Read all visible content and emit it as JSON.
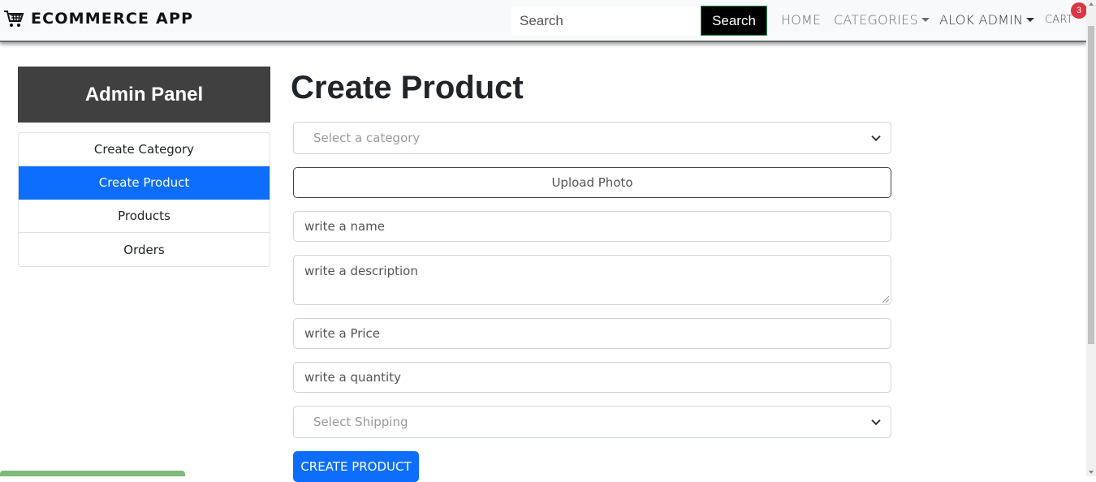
{
  "brand": {
    "title": "ECOMMERCE APP",
    "logo_icon": "shopping-cart-icon"
  },
  "search": {
    "placeholder": "Search",
    "button_label": "Search"
  },
  "nav": {
    "home": "HOME",
    "categories": "CATEGORIES",
    "user": "ALOK ADMIN",
    "cart": "CART",
    "cart_count": "3"
  },
  "sidebar": {
    "heading": "Admin Panel",
    "items": [
      {
        "label": "Create Category",
        "active": false
      },
      {
        "label": "Create Product",
        "active": true
      },
      {
        "label": "Products",
        "active": false
      },
      {
        "label": "Orders",
        "active": false
      }
    ]
  },
  "form": {
    "title": "Create Product",
    "category_placeholder": "Select a category",
    "upload_label": "Upload Photo",
    "name_placeholder": "write a name",
    "description_placeholder": "write a description",
    "price_placeholder": "write a Price",
    "quantity_placeholder": "write a quantity",
    "shipping_placeholder": "Select Shipping",
    "submit_label": "CREATE PRODUCT"
  },
  "colors": {
    "primary": "#0d6efd",
    "admin_header_bg": "#404040",
    "badge": "#dc3545",
    "navbar_bg": "#f8f9fa"
  }
}
